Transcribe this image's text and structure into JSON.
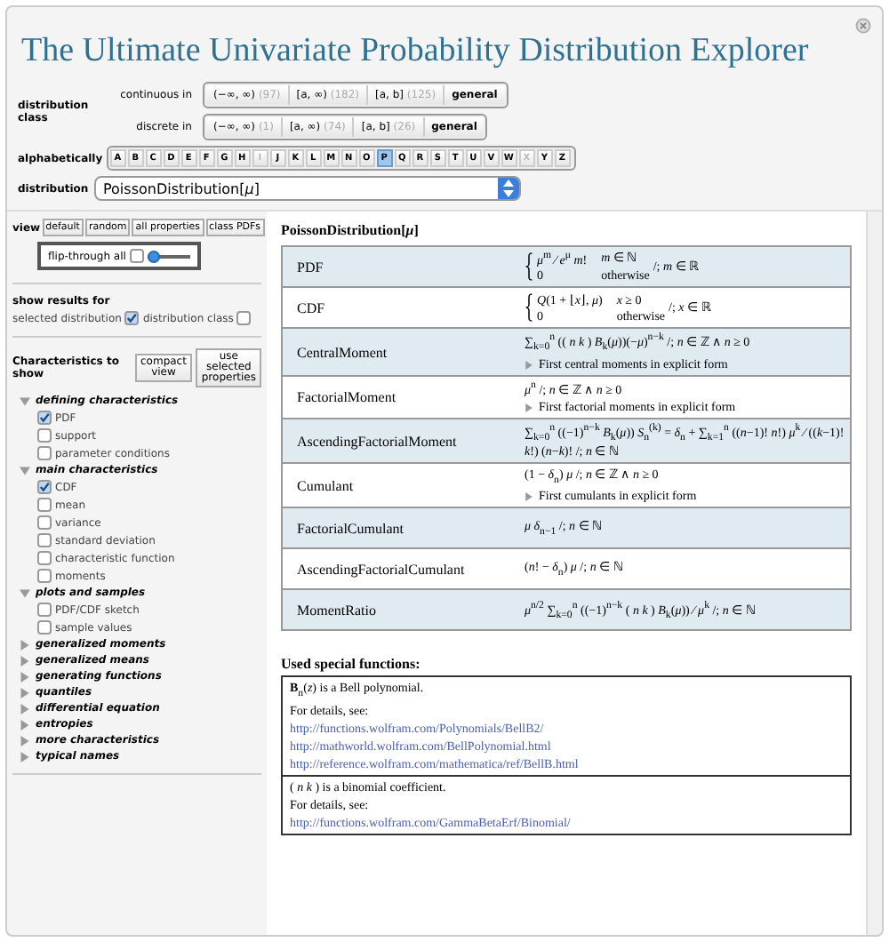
{
  "window": {
    "title": "The Ultimate Univariate Probability Distribution Explorer"
  },
  "distribution_class": {
    "label": "distribution class",
    "groups": [
      {
        "label": "continuous in",
        "buttons": [
          {
            "label": "(−∞, ∞)",
            "count": "(97)"
          },
          {
            "label": "[a, ∞)",
            "count": "(182)"
          },
          {
            "label": "[a, b]",
            "count": "(125)"
          },
          {
            "label": "general"
          }
        ]
      },
      {
        "label": "discrete in",
        "buttons": [
          {
            "label": "(−∞, ∞)",
            "count": "(1)"
          },
          {
            "label": "[a, ∞)",
            "count": "(74)"
          },
          {
            "label": "[a, b]",
            "count": "(26)"
          },
          {
            "label": "general"
          }
        ]
      }
    ]
  },
  "alphabetically": {
    "label": "alphabetically",
    "letters": [
      {
        "label": "A",
        "selected": false,
        "disabled": false
      },
      {
        "label": "B",
        "selected": false,
        "disabled": false
      },
      {
        "label": "C",
        "selected": false,
        "disabled": false
      },
      {
        "label": "D",
        "selected": false,
        "disabled": false
      },
      {
        "label": "E",
        "selected": false,
        "disabled": false
      },
      {
        "label": "F",
        "selected": false,
        "disabled": false
      },
      {
        "label": "G",
        "selected": false,
        "disabled": false
      },
      {
        "label": "H",
        "selected": false,
        "disabled": false
      },
      {
        "label": "I",
        "selected": false,
        "disabled": true
      },
      {
        "label": "J",
        "selected": false,
        "disabled": false
      },
      {
        "label": "K",
        "selected": false,
        "disabled": false
      },
      {
        "label": "L",
        "selected": false,
        "disabled": false
      },
      {
        "label": "M",
        "selected": false,
        "disabled": false
      },
      {
        "label": "N",
        "selected": false,
        "disabled": false
      },
      {
        "label": "O",
        "selected": false,
        "disabled": false
      },
      {
        "label": "P",
        "selected": true,
        "disabled": false
      },
      {
        "label": "Q",
        "selected": false,
        "disabled": false
      },
      {
        "label": "R",
        "selected": false,
        "disabled": false
      },
      {
        "label": "S",
        "selected": false,
        "disabled": false
      },
      {
        "label": "T",
        "selected": false,
        "disabled": false
      },
      {
        "label": "U",
        "selected": false,
        "disabled": false
      },
      {
        "label": "V",
        "selected": false,
        "disabled": false
      },
      {
        "label": "W",
        "selected": false,
        "disabled": false
      },
      {
        "label": "X",
        "selected": false,
        "disabled": true
      },
      {
        "label": "Y",
        "selected": false,
        "disabled": false
      },
      {
        "label": "Z",
        "selected": false,
        "disabled": false
      }
    ]
  },
  "distribution": {
    "label": "distribution",
    "value": "PoissonDistribution[*μ*]"
  },
  "view": {
    "label": "view",
    "buttons": [
      "default",
      "random",
      "all properties",
      "class PDFs"
    ],
    "flip_through": {
      "label": "flip-through all",
      "checked": false,
      "level": 0
    }
  },
  "show_results": {
    "label": "show results for",
    "options": [
      {
        "label": "selected distribution",
        "checked": true
      },
      {
        "label": "distribution class",
        "checked": false
      }
    ]
  },
  "characteristics": {
    "label": "Characteristics to show",
    "buttons": [
      "compact view",
      "use selected properties"
    ],
    "sections": [
      {
        "label": "defining characteristics",
        "expanded": true,
        "items": [
          {
            "label": "PDF",
            "checked": true
          },
          {
            "label": "support",
            "checked": false
          },
          {
            "label": "parameter conditions",
            "checked": false
          }
        ]
      },
      {
        "label": "main characteristics",
        "expanded": true,
        "items": [
          {
            "label": "CDF",
            "checked": true
          },
          {
            "label": "mean",
            "checked": false
          },
          {
            "label": "variance",
            "checked": false
          },
          {
            "label": "standard deviation",
            "checked": false
          },
          {
            "label": "characteristic function",
            "checked": false
          },
          {
            "label": "moments",
            "checked": false
          }
        ]
      },
      {
        "label": "plots and samples",
        "expanded": true,
        "items": [
          {
            "label": "PDF/CDF sketch",
            "checked": false
          },
          {
            "label": "sample values",
            "checked": false
          }
        ]
      },
      {
        "label": "generalized moments",
        "expanded": false
      },
      {
        "label": "generalized means",
        "expanded": false
      },
      {
        "label": "generating functions",
        "expanded": false
      },
      {
        "label": "quantiles",
        "expanded": false
      },
      {
        "label": "differential equation",
        "expanded": false
      },
      {
        "label": "entropies",
        "expanded": false
      },
      {
        "label": "more characteristics",
        "expanded": false
      },
      {
        "label": "typical names",
        "expanded": false
      }
    ]
  },
  "results": {
    "heading": "PoissonDistribution[*μ*]",
    "rows": [
      {
        "name": "PDF",
        "kind": "cases",
        "cases": [
          [
            "*μ*$^{m}$ ⁄ *e*$^{μ}$ *m*!",
            "*m* ∈ ℕ"
          ],
          [
            "0",
            "otherwise"
          ]
        ],
        "condition": "/; *m* ∈ ℝ"
      },
      {
        "name": "CDF",
        "kind": "cases",
        "cases": [
          [
            "*Q*(1 + ⌊*x*⌋, *μ*)",
            "*x* ≥ 0"
          ],
          [
            "0",
            "otherwise"
          ]
        ],
        "condition": "/; *x* ∈ ℝ"
      },
      {
        "name": "CentralMoment",
        "kind": "formula",
        "formula": "∑$_{k=0}$$^{n}$ (( *n* *k* ) *B*$_{k}$(*μ*))(−*μ*)$^{n−k}$ /; *n* ∈ ℤ ∧ *n* ≥ 0",
        "note": "First central moments in explicit form"
      },
      {
        "name": "FactorialMoment",
        "kind": "formula",
        "formula": "*μ*$^{n}$ /; *n* ∈ ℤ ∧ *n* ≥ 0",
        "note": "First factorial moments in explicit form"
      },
      {
        "name": "AscendingFactorialMoment",
        "kind": "formula",
        "formula": "∑$_{k=0}$$^{n}$ ((−1)$^{n−k}$ *B*$_{k}$(*μ*)) *S*$_{n}$$^{(k)}$ = *δ*$_{n}$ + ∑$_{k=1}$$^{n}$ ((*n*−1)! *n*!) *μ*$^{k}$ ⁄ ((*k*−1)! *k*!) (*n*−*k*)! /; *n* ∈ ℕ"
      },
      {
        "name": "Cumulant",
        "kind": "formula",
        "formula": "(1 − *δ*$_{n}$) *μ* /; *n* ∈ ℤ ∧ *n* ≥ 0",
        "note": "First cumulants in explicit form"
      },
      {
        "name": "FactorialCumulant",
        "kind": "formula",
        "formula": "*μ δ*$_{n−1}$ /; *n* ∈ ℕ"
      },
      {
        "name": "AscendingFactorialCumulant",
        "kind": "formula",
        "formula": "(*n*! − *δ*$_{n}$) *μ* /; *n* ∈ ℕ"
      },
      {
        "name": "MomentRatio",
        "kind": "formula",
        "formula": "*μ*$^{n/2}$ ∑$_{k=0}$$^{n}$ ((−1)$^{n−k}$ ( *n* *k* ) *B*$_{k}$(*μ*)) ⁄ *μ*$^{k}$ /; *n* ∈ ℕ"
      }
    ]
  },
  "special_functions": {
    "heading": "Used special functions:",
    "entries": [
      {
        "description": "**B**$_{n}$(*z*) is a Bell polynomial.",
        "details": "For details, see:",
        "links": [
          "http://functions.wolfram.com/Polynomials/BellB2/",
          "http://mathworld.wolfram.com/BellPolynomial.html",
          "http://reference.wolfram.com/mathematica/ref/BellB.html"
        ]
      },
      {
        "description": "( *n* *k* ) is a binomial coefficient.",
        "details": "For details, see:",
        "links": [
          "http://functions.wolfram.com/GammaBetaErf/Binomial/"
        ]
      }
    ]
  }
}
